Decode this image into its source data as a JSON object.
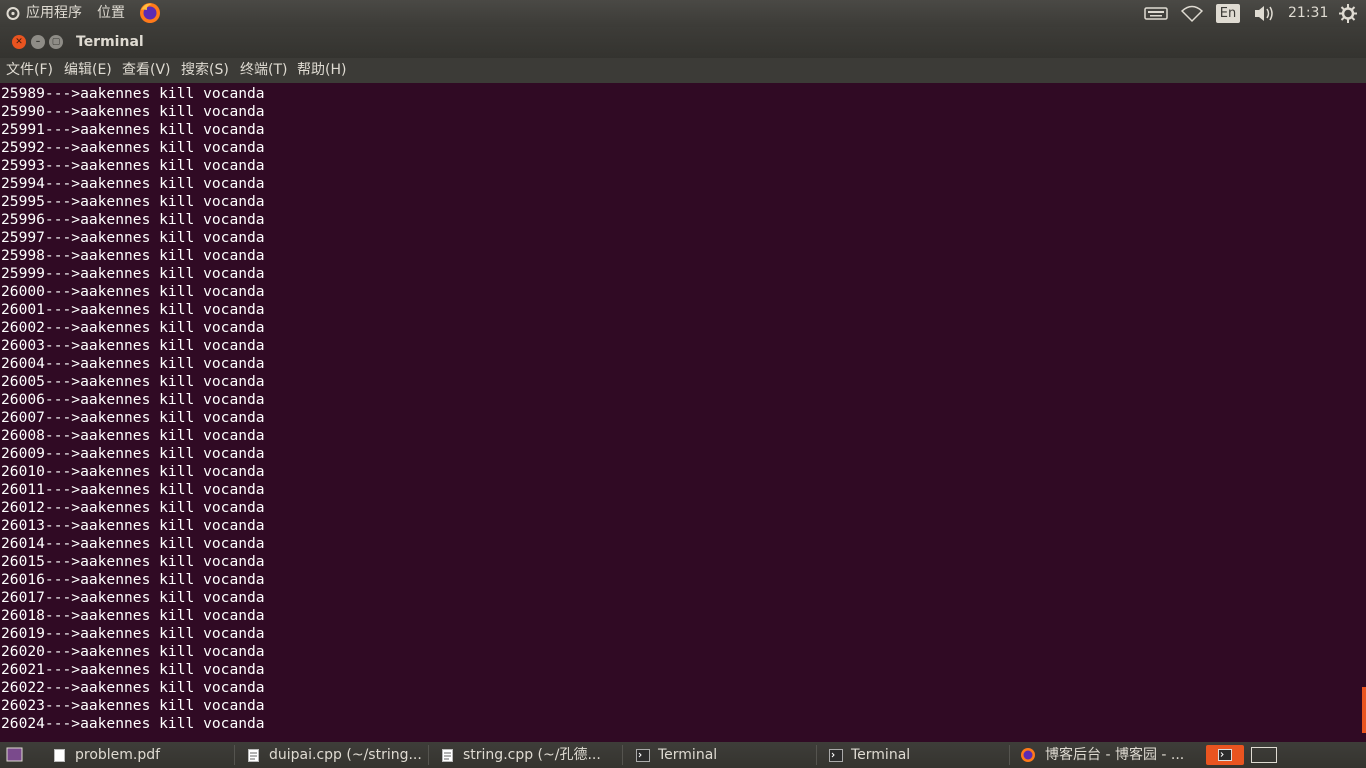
{
  "top_panel": {
    "apps_menu": "应用程序",
    "places_menu": "位置",
    "keyboard_layout": "En",
    "clock": "21:31",
    "icons": [
      "ubuntu-logo-icon",
      "firefox-icon",
      "keyboard-icon",
      "wifi-icon",
      "volume-icon",
      "power-gear-icon"
    ]
  },
  "window": {
    "title": "Terminal",
    "menu": [
      "文件(F)",
      "编辑(E)",
      "查看(V)",
      "搜索(S)",
      "终端(T)",
      "帮助(H)"
    ]
  },
  "terminal": {
    "lines": [
      "25989--->aakennes kill vocanda",
      "25990--->aakennes kill vocanda",
      "25991--->aakennes kill vocanda",
      "25992--->aakennes kill vocanda",
      "25993--->aakennes kill vocanda",
      "25994--->aakennes kill vocanda",
      "25995--->aakennes kill vocanda",
      "25996--->aakennes kill vocanda",
      "25997--->aakennes kill vocanda",
      "25998--->aakennes kill vocanda",
      "25999--->aakennes kill vocanda",
      "26000--->aakennes kill vocanda",
      "26001--->aakennes kill vocanda",
      "26002--->aakennes kill vocanda",
      "26003--->aakennes kill vocanda",
      "26004--->aakennes kill vocanda",
      "26005--->aakennes kill vocanda",
      "26006--->aakennes kill vocanda",
      "26007--->aakennes kill vocanda",
      "26008--->aakennes kill vocanda",
      "26009--->aakennes kill vocanda",
      "26010--->aakennes kill vocanda",
      "26011--->aakennes kill vocanda",
      "26012--->aakennes kill vocanda",
      "26013--->aakennes kill vocanda",
      "26014--->aakennes kill vocanda",
      "26015--->aakennes kill vocanda",
      "26016--->aakennes kill vocanda",
      "26017--->aakennes kill vocanda",
      "26018--->aakennes kill vocanda",
      "26019--->aakennes kill vocanda",
      "26020--->aakennes kill vocanda",
      "26021--->aakennes kill vocanda",
      "26022--->aakennes kill vocanda",
      "26023--->aakennes kill vocanda",
      "26024--->aakennes kill vocanda"
    ],
    "colors": {
      "background": "#300a24",
      "foreground": "#ffffff"
    }
  },
  "taskbar": {
    "items": [
      {
        "label": "problem.pdf",
        "icon": "document-icon"
      },
      {
        "label": "duipai.cpp (~/string...",
        "icon": "text-editor-icon"
      },
      {
        "label": "string.cpp (~/孔德...",
        "icon": "text-editor-icon"
      },
      {
        "label": "Terminal",
        "icon": "terminal-icon"
      },
      {
        "label": "Terminal",
        "icon": "terminal-icon"
      },
      {
        "label": "博客后台 - 博客园 - ...",
        "icon": "firefox-icon"
      }
    ],
    "workspace_active_color": "#e95420"
  },
  "colors": {
    "accent": "#e95420",
    "panel": "#3c3b37",
    "panel_text": "#dfdbd2"
  }
}
